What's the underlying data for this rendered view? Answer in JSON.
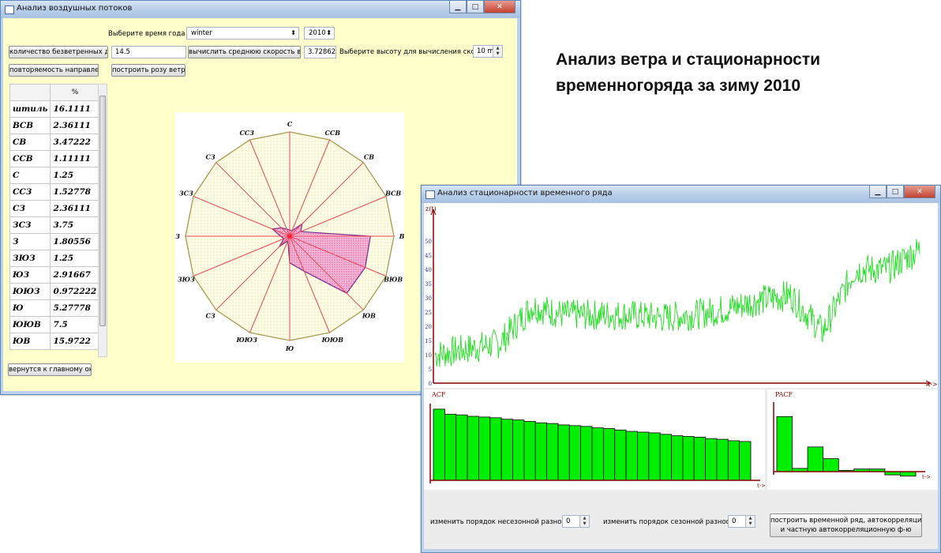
{
  "window1": {
    "title": "Анализ воздушных потоков",
    "season_label": "Выберите время года",
    "season_value": "winter",
    "year_value": "2010",
    "calm_days_button": "количество безветренных дней",
    "calm_days_value": "14.5",
    "avg_speed_button": "вычислить среднюю скорость ветра",
    "avg_speed_value": "3.72862",
    "height_label": "Выберите высоту для вычисления скорости:",
    "height_value": "10 m",
    "direction_freq_button": "повторяемость направлений",
    "wind_rose_button": "построить розу ветров",
    "back_button": "вернутся к главному окну",
    "table": {
      "header": "%",
      "rows": [
        {
          "dir": "штиль",
          "val": "16.1111"
        },
        {
          "dir": "ВСВ",
          "val": "2.36111"
        },
        {
          "dir": "СВ",
          "val": "3.47222"
        },
        {
          "dir": "ССВ",
          "val": "1.11111"
        },
        {
          "dir": "С",
          "val": "1.25"
        },
        {
          "dir": "ССЗ",
          "val": "1.52778"
        },
        {
          "dir": "СЗ",
          "val": "2.36111"
        },
        {
          "dir": "ЗСЗ",
          "val": "3.75"
        },
        {
          "dir": "З",
          "val": "1.80556"
        },
        {
          "dir": "ЗЮЗ",
          "val": "1.25"
        },
        {
          "dir": "ЮЗ",
          "val": "2.91667"
        },
        {
          "dir": "ЮЮЗ",
          "val": "0.972222"
        },
        {
          "dir": "Ю",
          "val": "5.27778"
        },
        {
          "dir": "ЮЮВ",
          "val": "7.5"
        },
        {
          "dir": "ЮВ",
          "val": "15.9722"
        }
      ]
    },
    "rose": {
      "labels": [
        "С",
        "ССВ",
        "СВ",
        "ВСВ",
        "В",
        "ВЮВ",
        "ЮВ",
        "ЮЮВ",
        "Ю",
        "ЮЮЗ",
        "СЗ",
        "ЗЮЗ",
        "З",
        "ЗСЗ",
        "СЗ",
        "ССЗ"
      ],
      "values": [
        1.25,
        1.11111,
        3.47222,
        2.36111,
        16.0,
        16.2,
        15.9722,
        7.5,
        5.27778,
        0.972222,
        2.91667,
        1.25,
        1.80556,
        3.75,
        2.36111,
        1.52778
      ]
    }
  },
  "heading": {
    "line1": "Анализ ветра и стационарности",
    "line2": "временногоряда за зиму 2010"
  },
  "window2": {
    "title": "Анализ стационарности временного ряда",
    "ts_y_label": "z(t)",
    "ts_x_label": "t->",
    "ts_yticks": [
      "0",
      "5",
      "10",
      "15",
      "20",
      "25",
      "30",
      "35",
      "40",
      "45",
      "50"
    ],
    "acf_label": "ACF",
    "pacf_label": "PACF",
    "acf_x_label": "t->",
    "pacf_x_label": "t->",
    "nonseasonal_label": "изменить порядок несезонной разности",
    "nonseasonal_value": "0",
    "seasonal_label": "изменить порядок сезонной разности",
    "seasonal_value": "0",
    "build_button_line1": "построить временной ряд, автокорреляционную",
    "build_button_line2": "и частную автокорреляционную ф-ю"
  },
  "chart_data": [
    {
      "type": "line",
      "title": "",
      "xlabel": "t->",
      "ylabel": "z(t)",
      "ylim": [
        0,
        55
      ],
      "series": [
        {
          "name": "z(t)",
          "color": "#22dd22"
        }
      ],
      "x": [
        0,
        40,
        80,
        120,
        160,
        200,
        240,
        280,
        320,
        360,
        400,
        440,
        480,
        520,
        560,
        600
      ],
      "values": [
        10,
        12,
        14,
        27,
        24,
        24,
        24,
        23,
        24,
        26,
        29,
        31,
        18,
        40,
        40,
        47
      ]
    },
    {
      "type": "bar",
      "title": "ACF",
      "series": [
        {
          "name": "ACF",
          "values": [
            0.99,
            0.92,
            0.91,
            0.89,
            0.88,
            0.87,
            0.85,
            0.84,
            0.82,
            0.8,
            0.79,
            0.77,
            0.76,
            0.75,
            0.73,
            0.72,
            0.7,
            0.68,
            0.67,
            0.66,
            0.64,
            0.62,
            0.61,
            0.6,
            0.58,
            0.57,
            0.55,
            0.54
          ]
        }
      ],
      "ylim": [
        0,
        1
      ],
      "color": "#00ee00"
    },
    {
      "type": "bar",
      "title": "PACF",
      "series": [
        {
          "name": "PACF",
          "values": [
            0.85,
            0.05,
            0.38,
            0.2,
            0.02,
            0.04,
            0.04,
            -0.05,
            -0.07
          ]
        }
      ],
      "ylim": [
        -0.2,
        1
      ],
      "color": "#00ee00"
    }
  ]
}
